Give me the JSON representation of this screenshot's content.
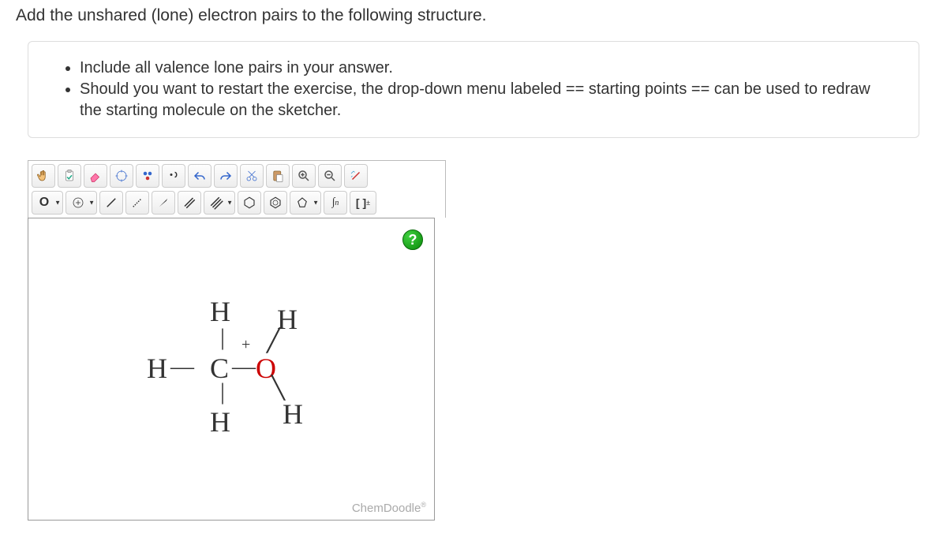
{
  "question_title": "Add the unshared (lone) electron pairs to the following structure.",
  "instructions": [
    "Include all valence lone pairs in your answer.",
    "Should you want to restart the exercise, the drop-down menu labeled == starting points == can be used to redraw the starting molecule on the sketcher."
  ],
  "toolbar": {
    "element_label": "O",
    "integral_label": "∫n",
    "bracket_label": "[ ]",
    "charge_label": "±"
  },
  "molecule": {
    "atoms": {
      "h_top_c": "H",
      "h_top_o": "H",
      "h_left": "H",
      "c_center": "C",
      "o_center": "O",
      "h_bot_c": "H",
      "h_bot_o": "H",
      "charge": "+"
    }
  },
  "help_label": "?",
  "watermark": "ChemDoodle"
}
